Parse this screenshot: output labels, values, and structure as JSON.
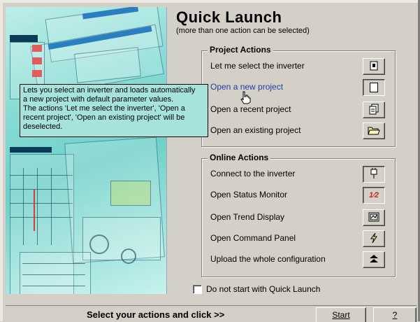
{
  "header": {
    "title": "Quick Launch",
    "subtitle": "(more than one action can be selected)"
  },
  "project_actions": {
    "title": "Project Actions",
    "items": [
      {
        "label": "Let me select the inverter",
        "icon": "inverter-select-icon"
      },
      {
        "label": "Open a new project",
        "icon": "new-document-icon"
      },
      {
        "label": "Open a recent project",
        "icon": "recent-project-icon"
      },
      {
        "label": "Open an existing project",
        "icon": "open-folder-icon"
      }
    ]
  },
  "online_actions": {
    "title": "Online Actions",
    "items": [
      {
        "label": "Connect to the inverter",
        "icon": "connect-plug-icon"
      },
      {
        "label": "Open Status Monitor",
        "icon": "status-monitor-icon",
        "icon_text": "1⁄2"
      },
      {
        "label": "Open Trend Display",
        "icon": "trend-display-icon"
      },
      {
        "label": "Open Command Panel",
        "icon": "lightning-icon"
      },
      {
        "label": "Upload the whole configuration",
        "icon": "upload-arrow-icon"
      }
    ]
  },
  "tooltip": {
    "lines": [
      "Lets you select an inverter and loads automatically",
      "a new project with default parameter values.",
      "The actions 'Let me select the inverter', 'Open a",
      "recent project', 'Open an existing project' will be",
      "deselected."
    ]
  },
  "options": {
    "no_quick_launch_label": "Do not start with Quick Launch",
    "no_quick_launch_checked": false
  },
  "footer": {
    "prompt": "Select your actions and click >>",
    "start_label": "Start",
    "help_label": "?"
  },
  "colors": {
    "background": "#d4d0c8",
    "tooltip_bg": "#a7e3dd",
    "picture_teal": "#6fd0c9",
    "hover_link": "#1f3ea8"
  }
}
